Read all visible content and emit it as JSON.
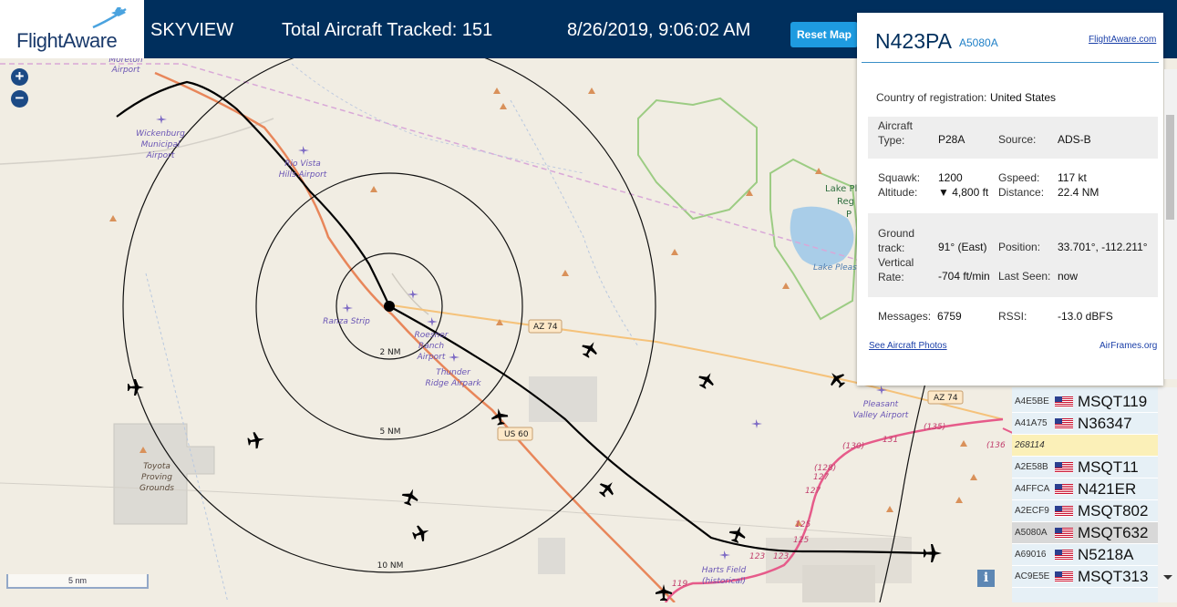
{
  "header": {
    "logo_text": "FlightAware",
    "app_name": "SKYVIEW",
    "total_tracked": "Total Aircraft Tracked: 151",
    "datetime": "8/26/2019, 9:06:02 AM",
    "reset_button": "Reset Map"
  },
  "map": {
    "zoom_in": "+",
    "zoom_out": "−",
    "scale": "5 nm",
    "info": "i",
    "range_labels": [
      "2 NM",
      "5 NM",
      "10 NM"
    ],
    "road_labels": [
      "AZ 74",
      "US 60",
      "AZ 74"
    ],
    "place_labels": [
      "Moreton Airport",
      "Wickenburg Municipal Airport",
      "Rio Vista Hills Airport",
      "Ranza Strip",
      "Roesner Ranch Airport",
      "Thunder Ridge Airpark",
      "Toyota Proving Grounds",
      "Lake Pleasant Regional Park",
      "Lake Pleasant",
      "Pleasant Valley Airport",
      "Harts Field (historical)"
    ],
    "route_numbers": [
      "(135)",
      "(136)",
      "(130)",
      "131",
      "(128)",
      "127",
      "127",
      "125",
      "125",
      "123",
      "123",
      "119"
    ]
  },
  "popup": {
    "registration": "N423PA",
    "hex": "A5080A",
    "link": "FlightAware.com",
    "country_label": "Country of registration:",
    "country_value": "United States",
    "aircraft_type_label": "Aircraft Type:",
    "aircraft_type_value": "P28A",
    "source_label": "Source:",
    "source_value": "ADS-B",
    "squawk_label": "Squawk:",
    "squawk_value": "1200",
    "gspeed_label": "Gspeed:",
    "gspeed_value": "117 kt",
    "altitude_label": "Altitude:",
    "altitude_value": "▼ 4,800 ft",
    "distance_label": "Distance:",
    "distance_value": "22.4 NM",
    "ground_track_label": "Ground track:",
    "ground_track_value": "91° (East)",
    "position_label": "Position:",
    "position_value": "33.701°, -112.211°",
    "vertical_rate_label": "Vertical Rate:",
    "vertical_rate_value": "-704 ft/min",
    "last_seen_label": "Last Seen:",
    "last_seen_value": "now",
    "messages_label": "Messages:",
    "messages_value": "6759",
    "rssi_label": "RSSI:",
    "rssi_value": "-13.0 dBFS",
    "photos_link": "See Aircraft Photos",
    "airframes_link": "AirFrames.org"
  },
  "aircraft_list": [
    {
      "hex": "A4E5BE",
      "ident": "MSQT119",
      "flag": true,
      "highlight": "none"
    },
    {
      "hex": "A41A75",
      "ident": "N36347",
      "flag": true,
      "highlight": "none"
    },
    {
      "hex": "268114",
      "ident": "",
      "flag": false,
      "highlight": "yellow"
    },
    {
      "hex": "A2E58B",
      "ident": "MSQT11",
      "flag": true,
      "highlight": "none"
    },
    {
      "hex": "A4FFCA",
      "ident": "N421ER",
      "flag": true,
      "highlight": "none"
    },
    {
      "hex": "A2ECF9",
      "ident": "MSQT802",
      "flag": true,
      "highlight": "none"
    },
    {
      "hex": "A5080A",
      "ident": "MSQT632",
      "flag": true,
      "highlight": "selected"
    },
    {
      "hex": "A69016",
      "ident": "N5218A",
      "flag": true,
      "highlight": "none"
    },
    {
      "hex": "AC9E5E",
      "ident": "MSQT313",
      "flag": true,
      "highlight": "none"
    }
  ],
  "colors": {
    "header_bg": "#002f5d",
    "accent": "#1e9be0",
    "map_bg": "#f1ede3",
    "selected_row": "#d8d8d8",
    "yellow_row": "#fbf0b8"
  }
}
